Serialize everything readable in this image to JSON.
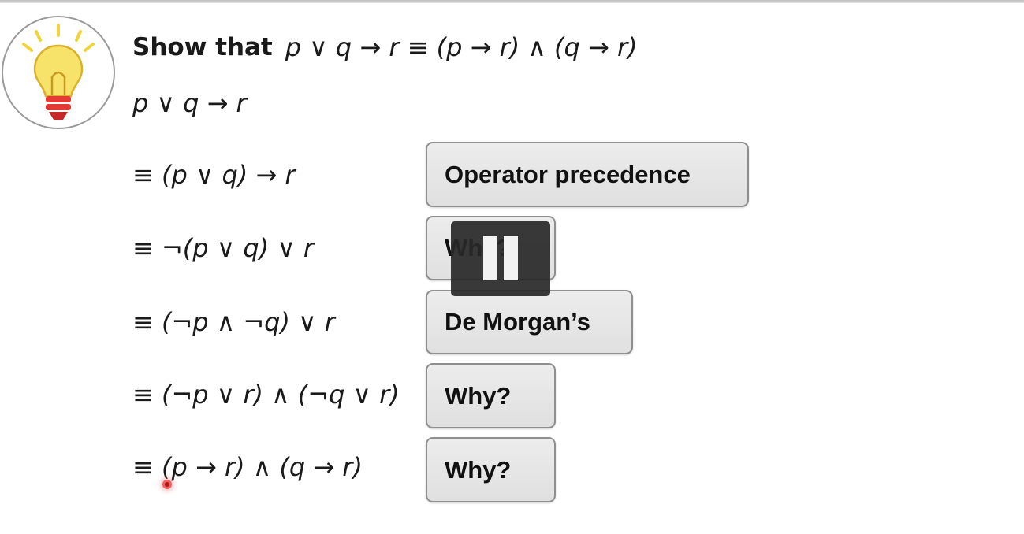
{
  "title": {
    "label": "Show that",
    "formula": "p ∨ q → r  ≡  (p → r) ∧ (q → r)"
  },
  "start_expression": "p ∨ q → r",
  "steps": [
    {
      "expression": "≡ (p ∨ q) → r",
      "reason": "Operator precedence"
    },
    {
      "expression": "≡ ¬(p ∨ q) ∨ r",
      "reason": "Why?"
    },
    {
      "expression": "≡ (¬p ∧ ¬q) ∨ r",
      "reason": "De Morgan’s"
    },
    {
      "expression": "≡ (¬p ∨ r) ∧ (¬q ∨ r)",
      "reason": "Why?"
    },
    {
      "expression": "≡ (p → r) ∧ (q → r)",
      "reason": "Why?"
    }
  ],
  "icons": {
    "badge": "lightbulb-icon",
    "overlay": "pause-icon",
    "pointer": "cursor-dot"
  },
  "colors": {
    "bulb_yellow": "#f7e36a",
    "bulb_base_red": "#e53935",
    "button_fill": "#e6e6e6",
    "button_border": "#8f8f8f",
    "overlay_bg": "#2b2b2b"
  }
}
